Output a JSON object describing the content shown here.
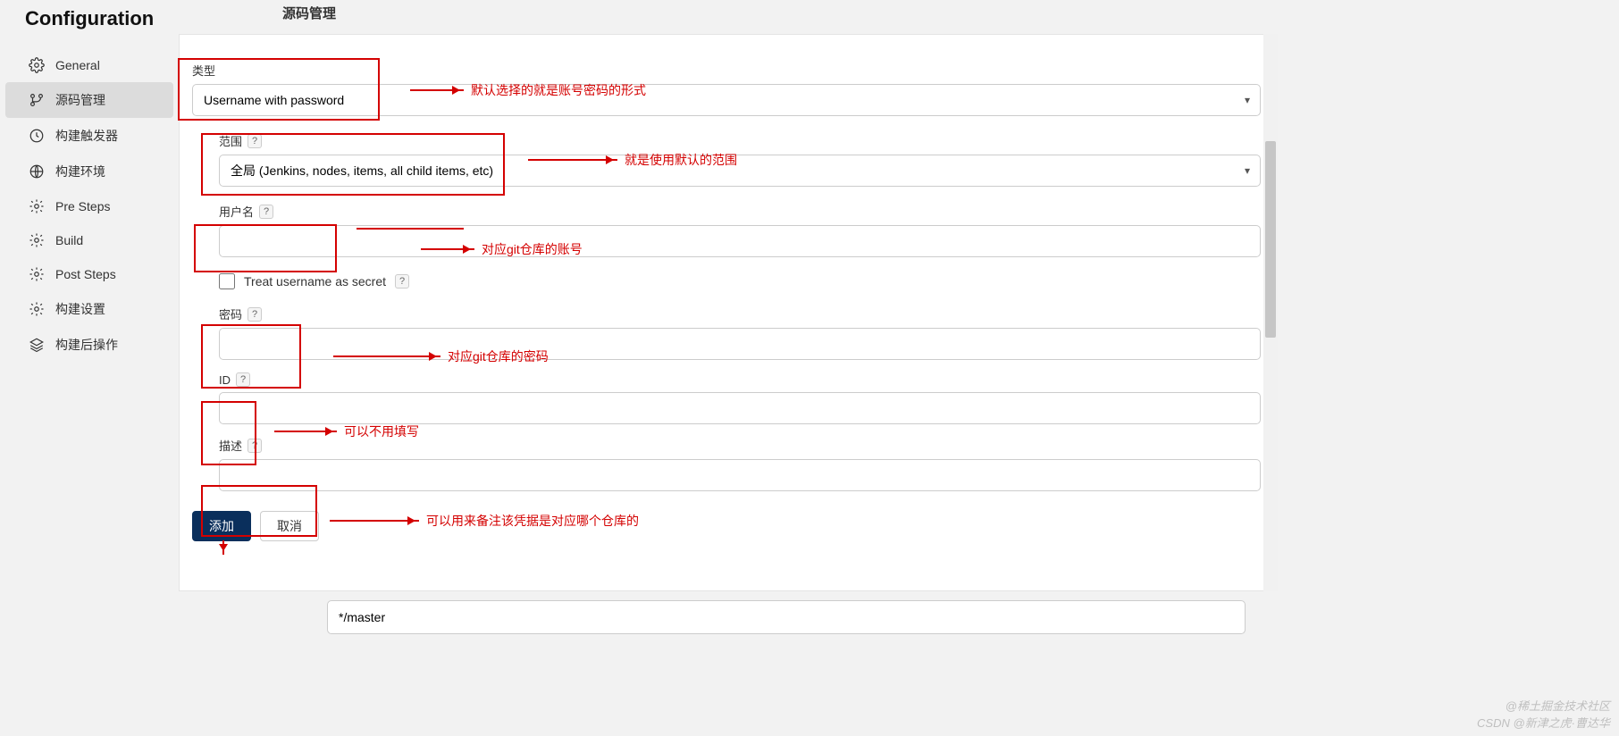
{
  "page": {
    "title": "Configuration",
    "header": "源码管理"
  },
  "sidebar": {
    "items": [
      {
        "label": "General"
      },
      {
        "label": "源码管理"
      },
      {
        "label": "构建触发器"
      },
      {
        "label": "构建环境"
      },
      {
        "label": "Pre Steps"
      },
      {
        "label": "Build"
      },
      {
        "label": "Post Steps"
      },
      {
        "label": "构建设置"
      },
      {
        "label": "构建后操作"
      }
    ]
  },
  "form": {
    "type_label": "类型",
    "type_value": "Username with password",
    "scope_label": "范围",
    "scope_value": "全局 (Jenkins, nodes, items, all child items, etc)",
    "username_label": "用户名",
    "username_value": "",
    "treat_secret_label": "Treat username as secret",
    "password_label": "密码",
    "password_value": "",
    "id_label": "ID",
    "id_value": "",
    "desc_label": "描述",
    "desc_value": "",
    "help": "?"
  },
  "buttons": {
    "add": "添加",
    "cancel": "取消"
  },
  "annotations": {
    "type": "默认选择的就是账号密码的形式",
    "scope": "就是使用默认的范围",
    "username": "对应git仓库的账号",
    "password": "对应git仓库的密码",
    "id": "可以不用填写",
    "desc": "可以用来备注该凭据是对应哪个仓库的"
  },
  "bottom": {
    "branch": "*/master"
  },
  "watermark": {
    "line1": "@稀土掘金技术社区",
    "line2": "CSDN @新津之虎·曹达华"
  }
}
